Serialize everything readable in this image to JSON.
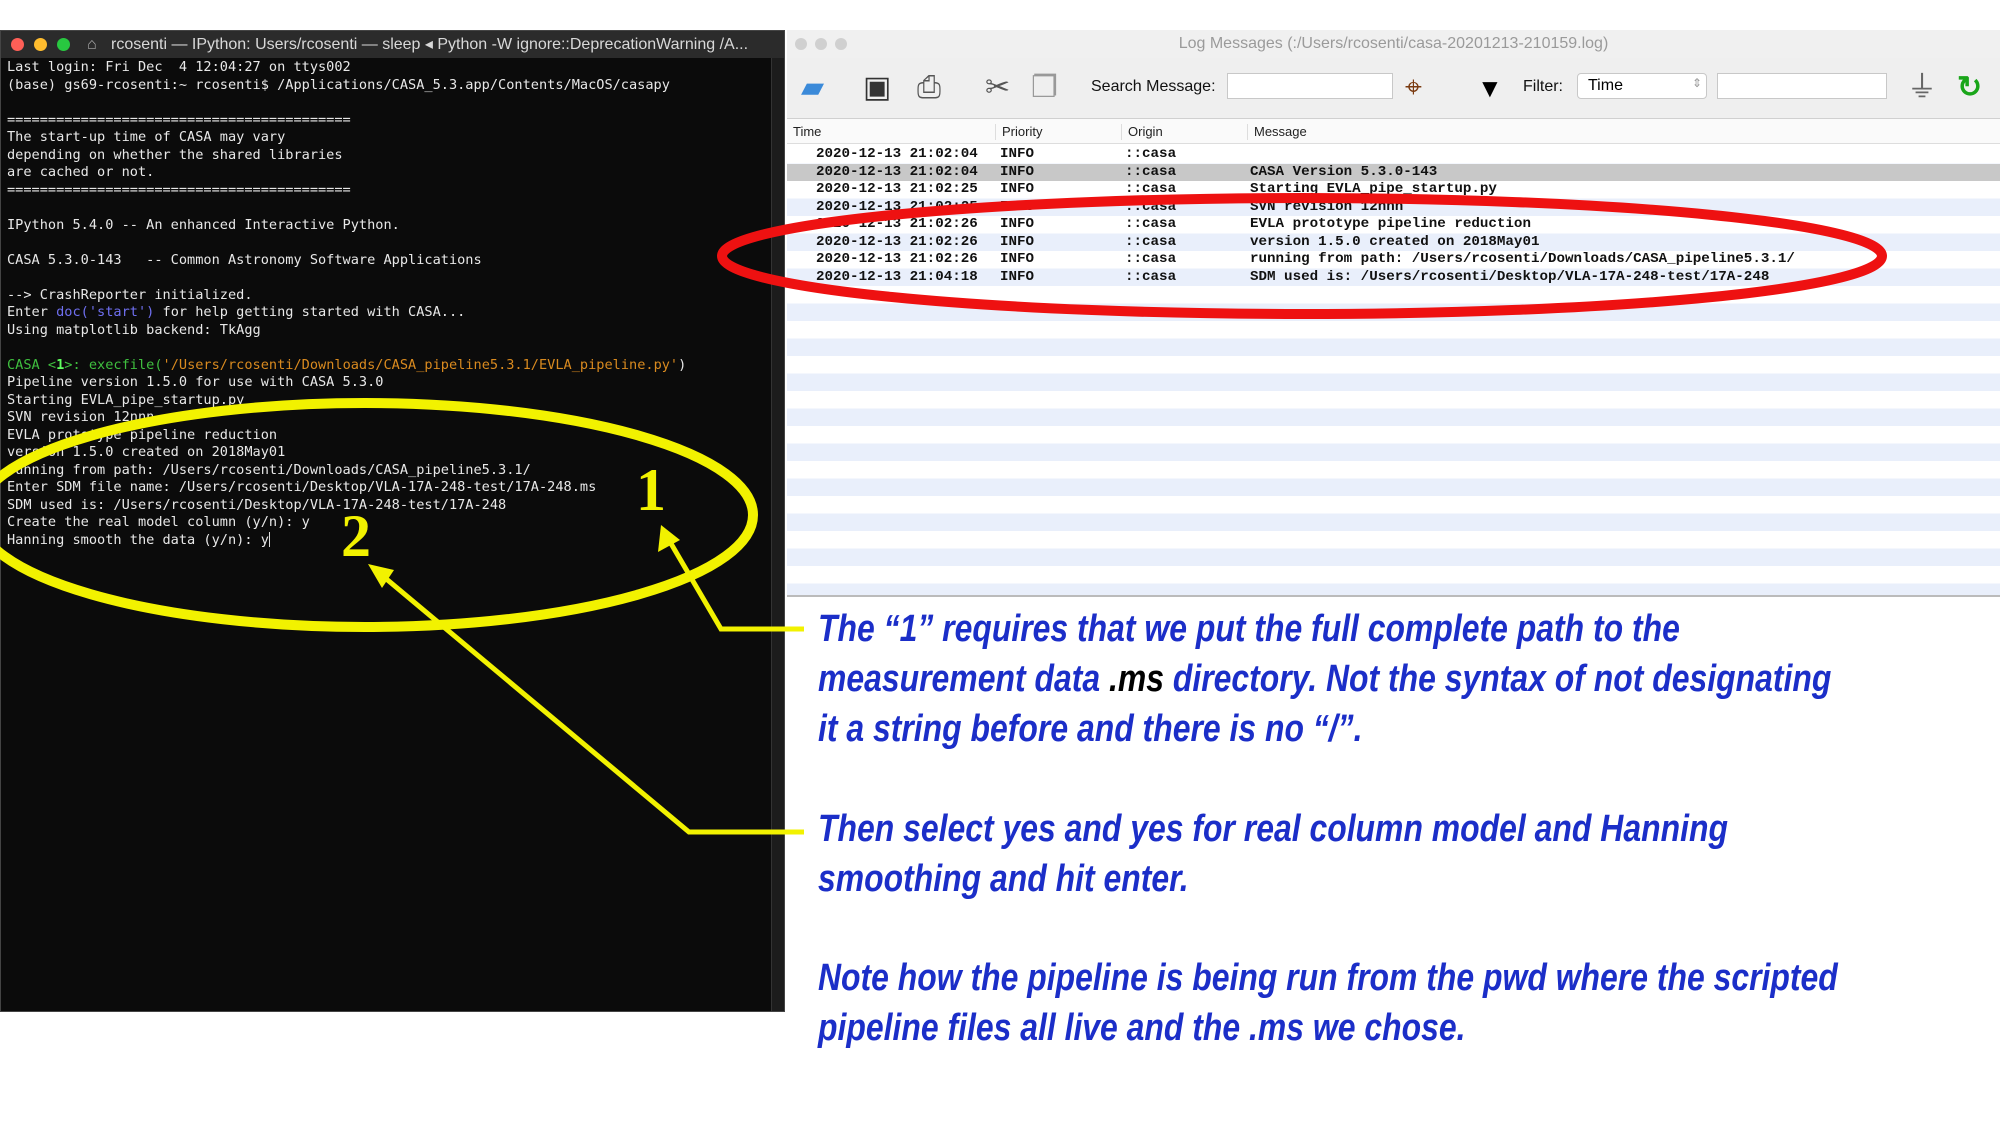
{
  "terminal": {
    "title": "rcosenti — IPython: Users/rcosenti — sleep ◂ Python -W ignore::DeprecationWarning /A...",
    "lines_top": [
      "Last login: Fri Dec  4 12:04:27 on ttys002",
      "(base) gs69-rcosenti:~ rcosenti$ /Applications/CASA_5.3.app/Contents/MacOS/casapy",
      "",
      "==========================================",
      "The start-up time of CASA may vary",
      "depending on whether the shared libraries",
      "are cached or not.",
      "==========================================",
      "",
      "IPython 5.4.0 -- An enhanced Interactive Python.",
      "",
      "CASA 5.3.0-143   -- Common Astronomy Software Applications",
      "",
      "--> CrashReporter initialized."
    ],
    "doc_line": {
      "pre": "Enter ",
      "code": "doc('start')",
      "post": " for help getting started with CASA..."
    },
    "backend_line": "Using matplotlib backend: TkAgg",
    "prompt": {
      "prefix": "CASA <",
      "num": "1",
      "suffix": ">: execfile(",
      "arg": "'/Users/rcosenti/Downloads/CASA_pipeline5.3.1/EVLA_pipeline.py'",
      "close": ")"
    },
    "lines_bottom": [
      "Pipeline version 1.5.0 for use with CASA 5.3.0",
      "Starting EVLA_pipe_startup.py",
      "SVN revision 12nnn",
      "EVLA prototype pipeline reduction",
      "version 1.5.0 created on 2018May01",
      "running from path: /Users/rcosenti/Downloads/CASA_pipeline5.3.1/",
      "Enter SDM file name: /Users/rcosenti/Desktop/VLA-17A-248-test/17A-248.ms",
      "SDM used is: /Users/rcosenti/Desktop/VLA-17A-248-test/17A-248",
      "Create the real model column (y/n): y",
      "Hanning smooth the data (y/n): y"
    ]
  },
  "log": {
    "title": "Log Messages (:/Users/rcosenti/casa-20201213-210159.log)",
    "search_label": "Search Message:",
    "search_value": "",
    "filter_label": "Filter:",
    "filter_selected": "Time",
    "filter_value": "",
    "columns": [
      "Time",
      "Priority",
      "Origin",
      "Message"
    ],
    "rows": [
      {
        "time": "2020-12-13 21:02:04",
        "priority": "INFO",
        "origin": "::casa",
        "message": ""
      },
      {
        "time": "2020-12-13 21:02:04",
        "priority": "INFO",
        "origin": "::casa",
        "message": "CASA Version 5.3.0-143"
      },
      {
        "time": "2020-12-13 21:02:25",
        "priority": "INFO",
        "origin": "::casa",
        "message": "Starting EVLA_pipe_startup.py"
      },
      {
        "time": "2020-12-13 21:02:25",
        "priority": "INFO",
        "origin": "::casa",
        "message": "SVN revision 12nnn"
      },
      {
        "time": "2020-12-13 21:02:26",
        "priority": "INFO",
        "origin": "::casa",
        "message": "EVLA prototype pipeline reduction"
      },
      {
        "time": "2020-12-13 21:02:26",
        "priority": "INFO",
        "origin": "::casa",
        "message": "version 1.5.0 created on 2018May01"
      },
      {
        "time": "2020-12-13 21:02:26",
        "priority": "INFO",
        "origin": "::casa",
        "message": "running from path: /Users/rcosenti/Downloads/CASA_pipeline5.3.1/"
      },
      {
        "time": "2020-12-13 21:04:18",
        "priority": "INFO",
        "origin": "::casa",
        "message": "SDM used is: /Users/rcosenti/Desktop/VLA-17A-248-test/17A-248"
      }
    ],
    "selected_row": 1
  },
  "annotations": {
    "marker1": "1",
    "marker2": "2",
    "note1": {
      "line1": "The “1” requires that we put the full complete path to the",
      "line2_pre": "measurement data ",
      "line2_ms": ".ms",
      "line2_post": " directory. Not the syntax of not designating",
      "line3": "it a string before and there is no “/”."
    },
    "note2": [
      "Then select yes and yes for real column model and Hanning",
      "smoothing and hit enter."
    ],
    "note3": [
      "Note how the pipeline is being run from the pwd where the scripted",
      "pipeline files all live and the .ms we chose."
    ],
    "colors": {
      "text": "#1b2ec8",
      "yellow": "#f2f200",
      "red": "#ee1111"
    }
  }
}
